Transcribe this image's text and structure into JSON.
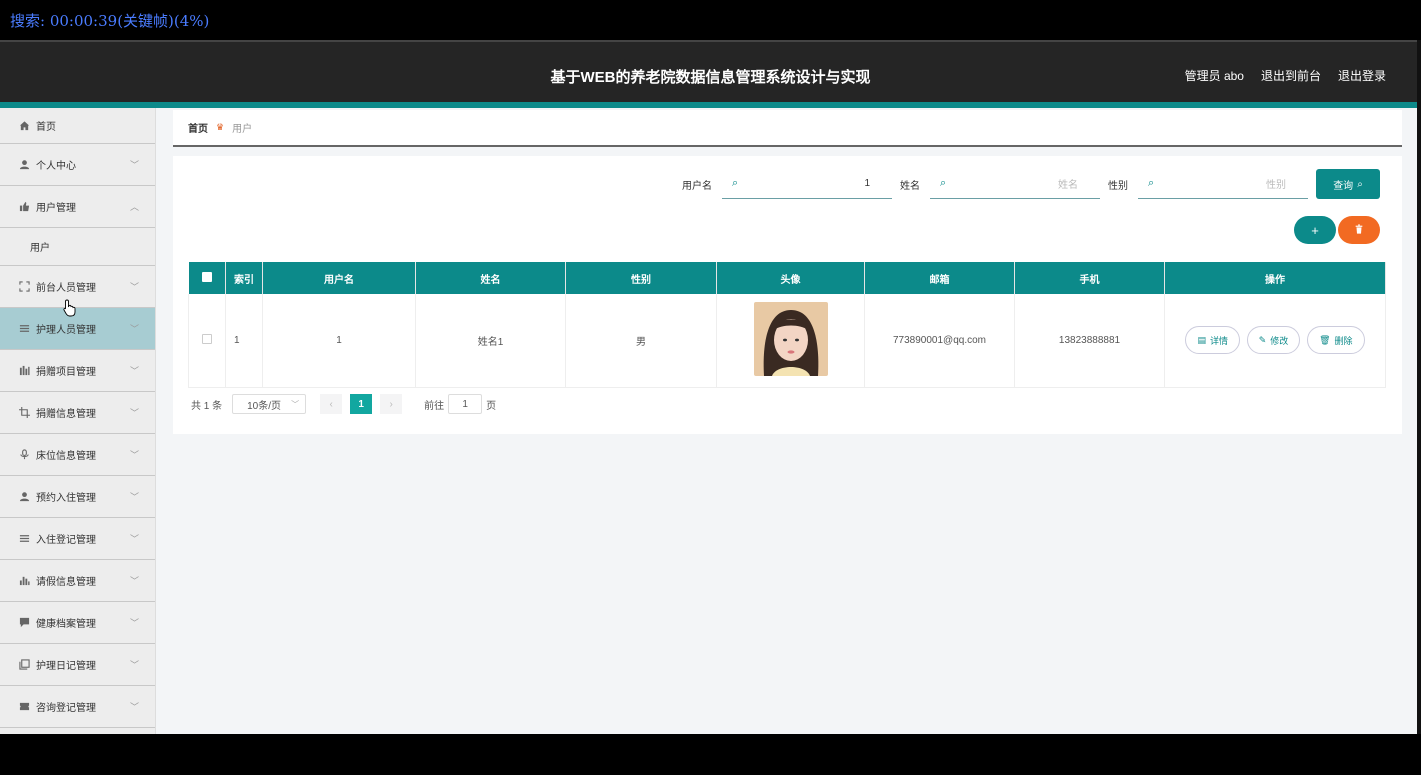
{
  "overlay": {
    "text": "搜索: 00:00:39(关键帧)(4%)"
  },
  "header": {
    "title": "基于WEB的养老院数据信息管理系统设计与实现",
    "admin": "管理员 abo",
    "to_front": "退出到前台",
    "logout": "退出登录"
  },
  "sidebar": {
    "items": [
      {
        "label": "首页",
        "icon": "home-icon"
      },
      {
        "label": "个人中心",
        "icon": "person-icon"
      },
      {
        "label": "用户管理",
        "icon": "thumb-icon"
      },
      {
        "label": "用户",
        "icon": ""
      },
      {
        "label": "前台人员管理",
        "icon": "frame-icon"
      },
      {
        "label": "护理人员管理",
        "icon": "menu-icon"
      },
      {
        "label": "捐赠项目管理",
        "icon": "bar-icon"
      },
      {
        "label": "捐赠信息管理",
        "icon": "crop-icon"
      },
      {
        "label": "床位信息管理",
        "icon": "mic-icon"
      },
      {
        "label": "预约入住管理",
        "icon": "person-icon"
      },
      {
        "label": "入住登记管理",
        "icon": "menu-icon"
      },
      {
        "label": "请假信息管理",
        "icon": "chart-icon"
      },
      {
        "label": "健康档案管理",
        "icon": "chat-icon"
      },
      {
        "label": "护理日记管理",
        "icon": "copy-icon"
      },
      {
        "label": "咨询登记管理",
        "icon": "ticket-icon"
      }
    ]
  },
  "breadcrumb": {
    "home": "首页",
    "current": "用户"
  },
  "search": {
    "username_label": "用户名",
    "username_value": "1",
    "name_label": "姓名",
    "name_placeholder": "姓名",
    "gender_label": "性别",
    "gender_placeholder": "性别",
    "query_label": "查询"
  },
  "actions": {
    "add_label": "+",
    "delete_label": "🗑"
  },
  "table": {
    "headers": [
      "索引",
      "用户名",
      "姓名",
      "性别",
      "头像",
      "邮箱",
      "手机",
      "操作"
    ],
    "rows": [
      {
        "index": "1",
        "username": "1",
        "name": "姓名1",
        "gender": "男",
        "email": "773890001@qq.com",
        "phone": "13823888881"
      }
    ],
    "op_detail": "详情",
    "op_edit": "修改",
    "op_delete": "删除"
  },
  "pagination": {
    "total": "共 1 条",
    "page_size": "10条/页",
    "current_page": "1",
    "goto_prefix": "前往",
    "goto_value": "1",
    "goto_suffix": "页"
  },
  "colors": {
    "accent": "#0c8a8a",
    "danger": "#f26a22",
    "header_bg": "#252525",
    "sidebar_active": "#a7ccd2"
  }
}
